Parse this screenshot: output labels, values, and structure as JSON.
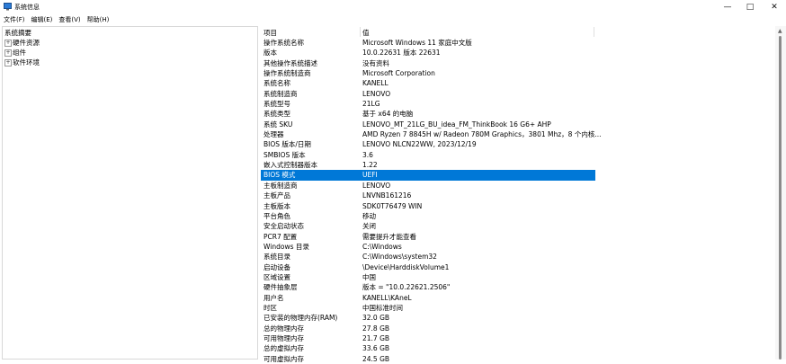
{
  "window": {
    "title": "系统信息"
  },
  "menu": [
    "文件(F)",
    "编辑(E)",
    "查看(V)",
    "帮助(H)"
  ],
  "tree": {
    "root": "系统摘要",
    "children": [
      "硬件资源",
      "组件",
      "软件环境"
    ]
  },
  "list": {
    "col_item": "项目",
    "col_value": "值",
    "rows": [
      {
        "k": "操作系统名称",
        "v": "Microsoft Windows 11 家庭中文版"
      },
      {
        "k": "版本",
        "v": "10.0.22631 版本 22631"
      },
      {
        "k": "其他操作系统描述",
        "v": "没有资料"
      },
      {
        "k": "操作系统制造商",
        "v": "Microsoft Corporation"
      },
      {
        "k": "系统名称",
        "v": "KANELL"
      },
      {
        "k": "系统制造商",
        "v": "LENOVO"
      },
      {
        "k": "系统型号",
        "v": "21LG"
      },
      {
        "k": "系统类型",
        "v": "基于 x64 的电脑"
      },
      {
        "k": "系统 SKU",
        "v": "LENOVO_MT_21LG_BU_idea_FM_ThinkBook 16 G6+ AHP"
      },
      {
        "k": "处理器",
        "v": "AMD Ryzen 7 8845H w/ Radeon 780M Graphics，3801 Mhz，8 个内核..."
      },
      {
        "k": "BIOS 版本/日期",
        "v": "LENOVO NLCN22WW, 2023/12/19"
      },
      {
        "k": "SMBIOS 版本",
        "v": "3.6"
      },
      {
        "k": "嵌入式控制器版本",
        "v": "1.22"
      },
      {
        "k": "BIOS 模式",
        "v": "UEFI"
      },
      {
        "k": "主板制造商",
        "v": "LENOVO"
      },
      {
        "k": "主板产品",
        "v": "LNVNB161216"
      },
      {
        "k": "主板版本",
        "v": "SDK0T76479 WIN"
      },
      {
        "k": "平台角色",
        "v": "移动"
      },
      {
        "k": "安全启动状态",
        "v": "关闭"
      },
      {
        "k": "PCR7 配置",
        "v": "需要提升才能查看"
      },
      {
        "k": "Windows 目录",
        "v": "C:\\Windows"
      },
      {
        "k": "系统目录",
        "v": "C:\\Windows\\system32"
      },
      {
        "k": "启动设备",
        "v": "\\Device\\HarddiskVolume1"
      },
      {
        "k": "区域设置",
        "v": "中国"
      },
      {
        "k": "硬件抽象层",
        "v": "版本 = \"10.0.22621.2506\""
      },
      {
        "k": "用户名",
        "v": "KANELL\\KAneL"
      },
      {
        "k": "时区",
        "v": "中国标准时间"
      },
      {
        "k": "已安装的物理内存(RAM)",
        "v": "32.0 GB"
      },
      {
        "k": "总的物理内存",
        "v": "27.8 GB"
      },
      {
        "k": "可用物理内存",
        "v": "21.7 GB"
      },
      {
        "k": "总的虚拟内存",
        "v": "33.6 GB"
      },
      {
        "k": "可用虚拟内存",
        "v": "24.5 GB"
      }
    ],
    "selected_index": 13
  },
  "colors": {
    "selection": "#0078d7"
  },
  "icons": {
    "app": "system-info-icon",
    "minimize": "minimize-icon",
    "maximize": "maximize-icon",
    "close": "close-icon"
  }
}
